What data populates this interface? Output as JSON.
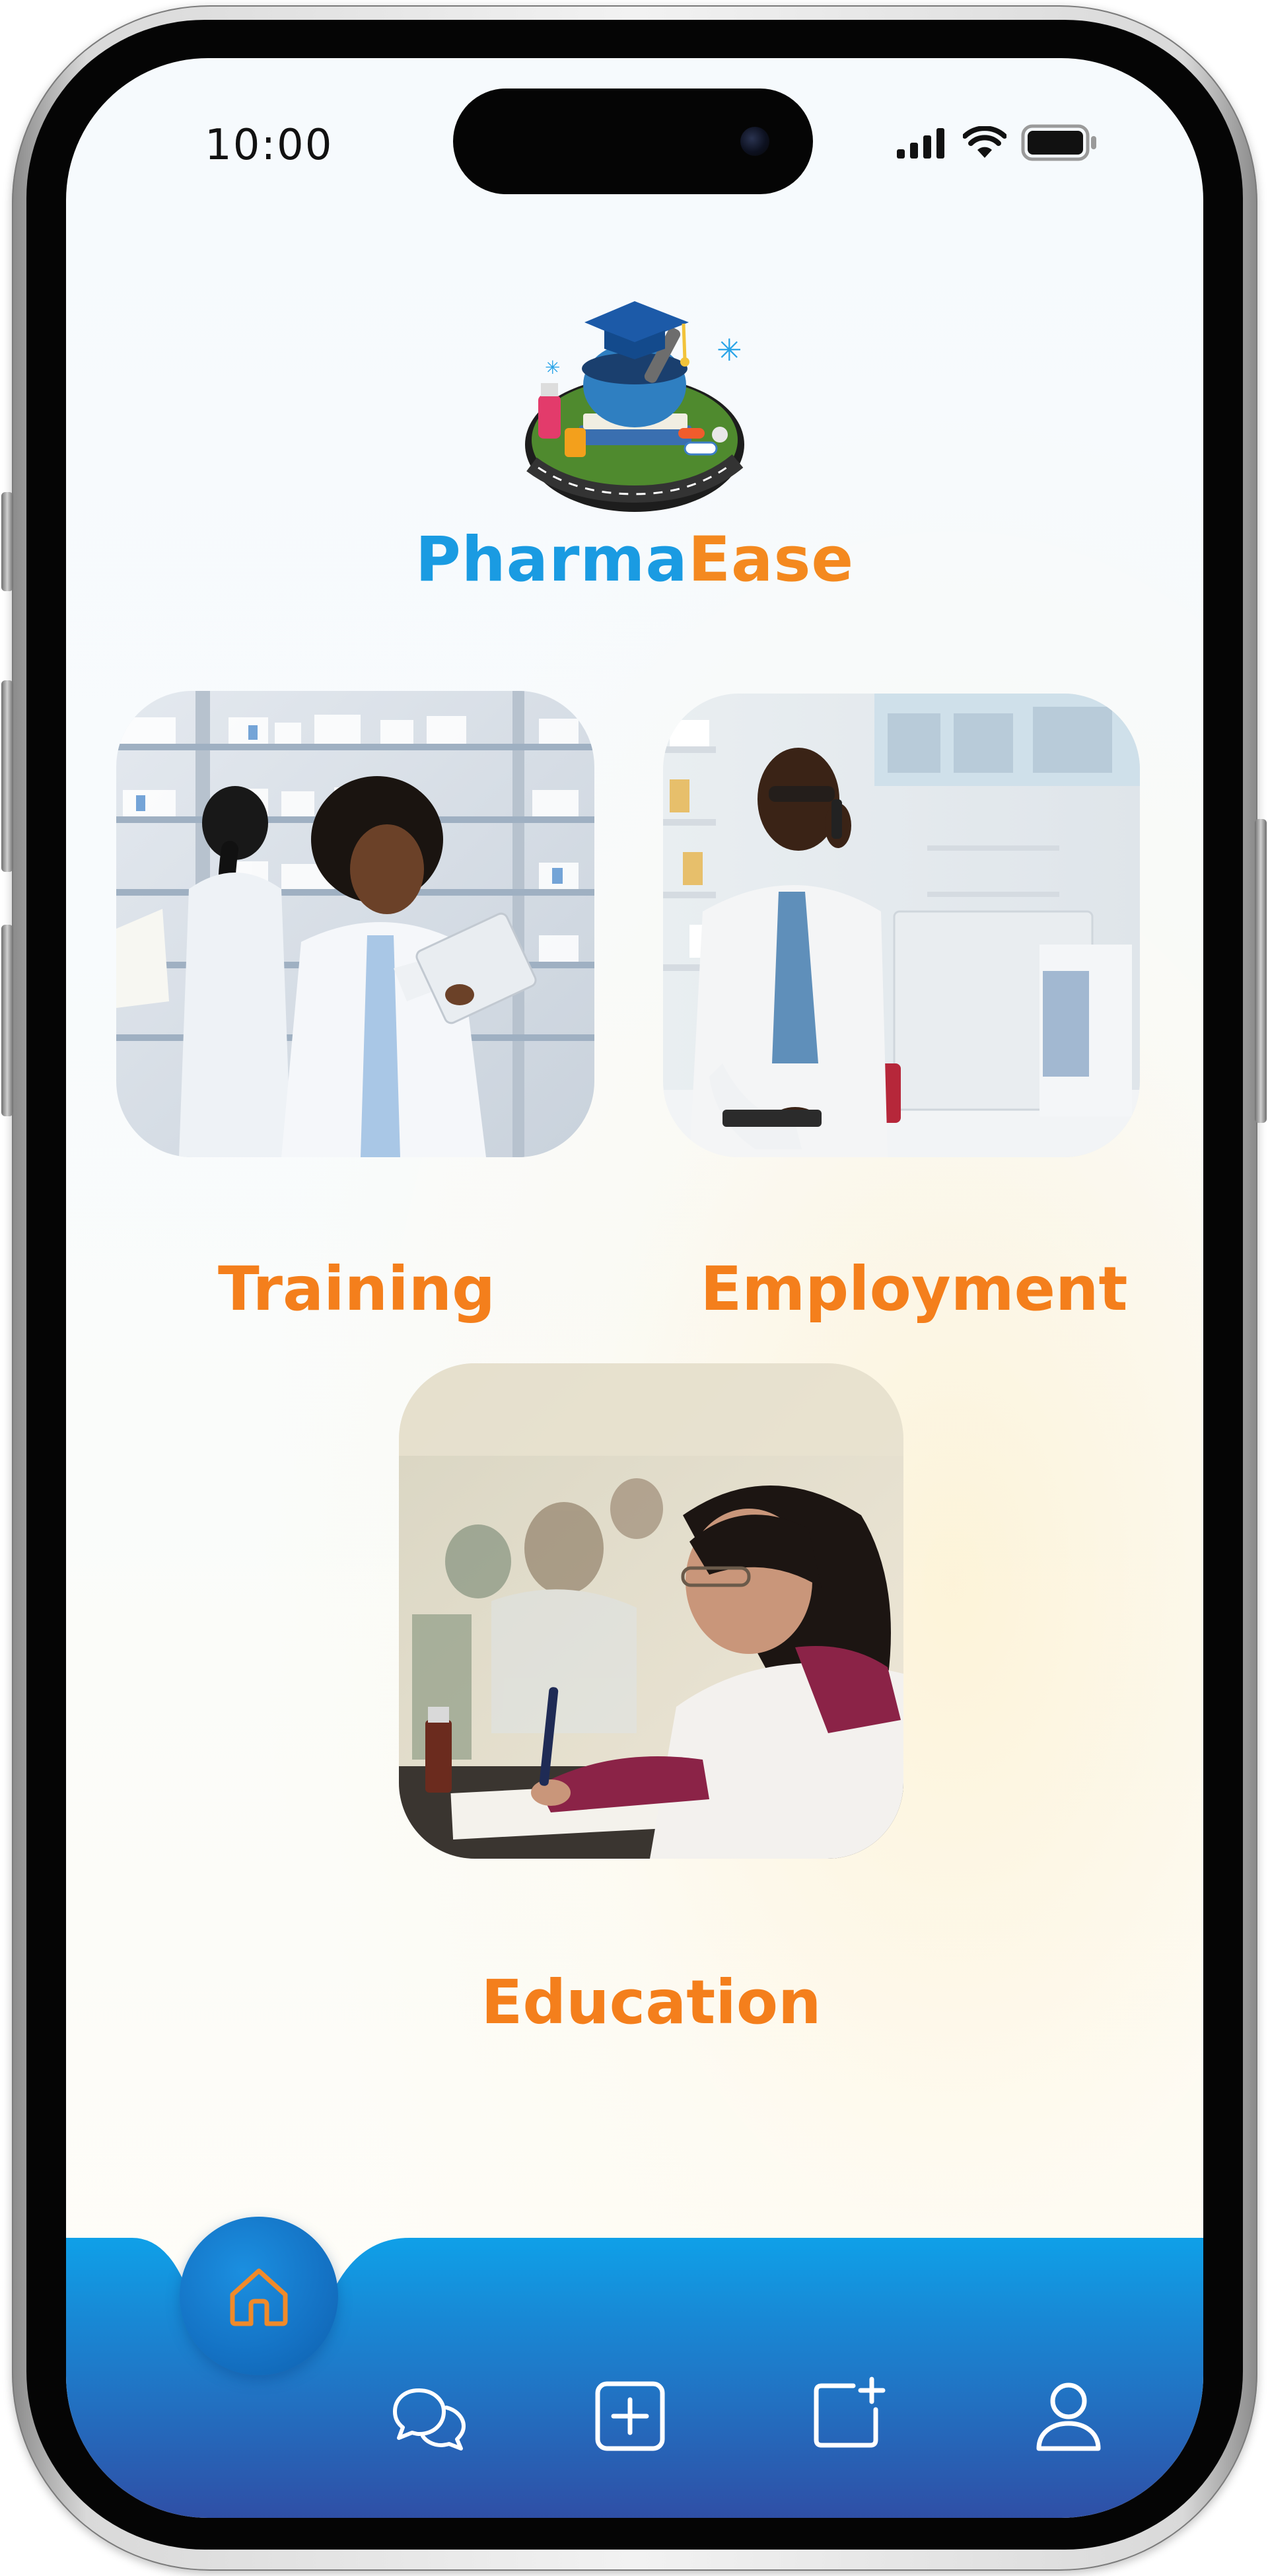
{
  "status_bar": {
    "time": "10:00"
  },
  "brand": {
    "name_part1": "Pharma",
    "name_part2": "Ease"
  },
  "cards": {
    "training": {
      "label": "Training"
    },
    "employment": {
      "label": "Employment"
    },
    "education": {
      "label": "Education"
    }
  },
  "bottom_nav": {
    "items": [
      {
        "icon": "home-icon",
        "active": true
      },
      {
        "icon": "chat-icon",
        "active": false
      },
      {
        "icon": "add-square-icon",
        "active": false
      },
      {
        "icon": "new-post-icon",
        "active": false
      },
      {
        "icon": "profile-icon",
        "active": false
      }
    ]
  },
  "colors": {
    "brand_blue": "#1a9be2",
    "brand_orange": "#f4891f",
    "label_orange": "#f47f1c",
    "nav_blue_top": "#0fa0e8",
    "nav_blue_bottom": "#2f4fa6",
    "home_icon_orange": "#f08a2a"
  }
}
